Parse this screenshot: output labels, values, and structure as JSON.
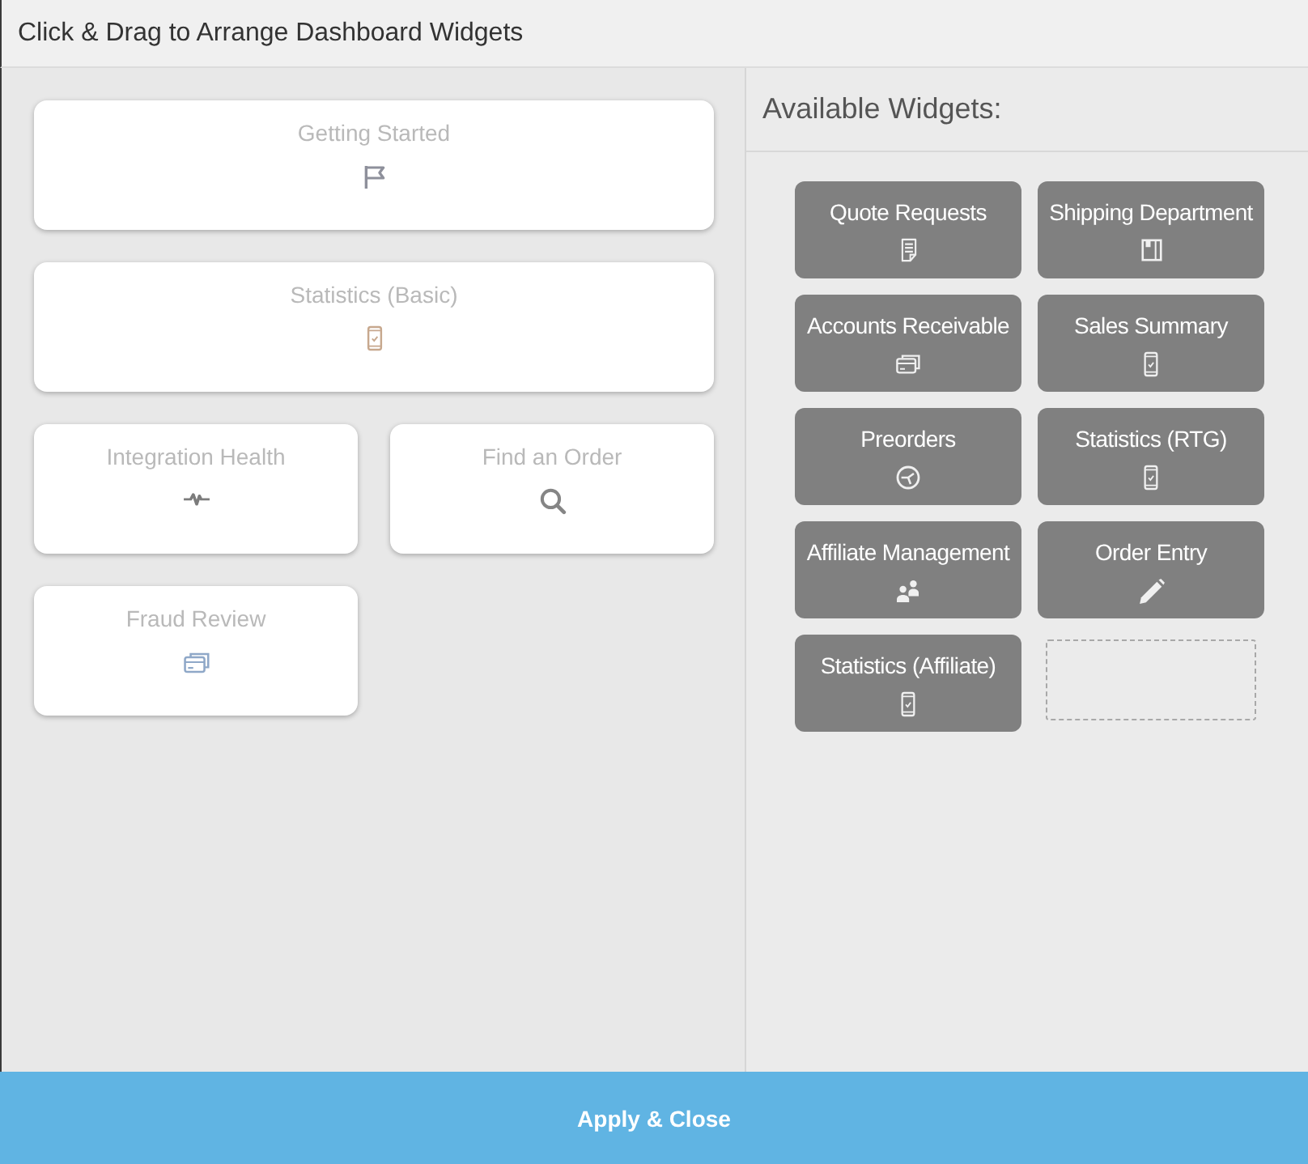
{
  "window": {
    "title": "Click & Drag to Arrange Dashboard Widgets"
  },
  "dashboard": {
    "widgets": [
      {
        "title": "Getting Started",
        "kind": "wide"
      },
      {
        "title": "Statistics (Basic)",
        "kind": "wide"
      },
      {
        "title": "Integration Health",
        "kind": "narrow"
      },
      {
        "title": "Find an Order",
        "kind": "narrow"
      },
      {
        "title": "Fraud Review",
        "kind": "narrow"
      }
    ]
  },
  "available": {
    "heading": "Available Widgets:",
    "widgets": [
      {
        "kind": "widget",
        "title": "Quote Requests"
      },
      {
        "kind": "widget",
        "title": "Shipping Department"
      },
      {
        "kind": "widget",
        "title": "Accounts Receivable"
      },
      {
        "kind": "widget",
        "title": "Sales Summary"
      },
      {
        "kind": "widget",
        "title": "Preorders"
      },
      {
        "kind": "widget",
        "title": "Statistics (RTG)"
      },
      {
        "kind": "widget",
        "title": "Affiliate Management"
      },
      {
        "kind": "widget",
        "title": "Order Entry"
      },
      {
        "kind": "widget",
        "title": "Statistics (Affiliate)"
      },
      {
        "kind": "slot"
      }
    ]
  },
  "footer": {
    "button": "Apply & Close"
  }
}
